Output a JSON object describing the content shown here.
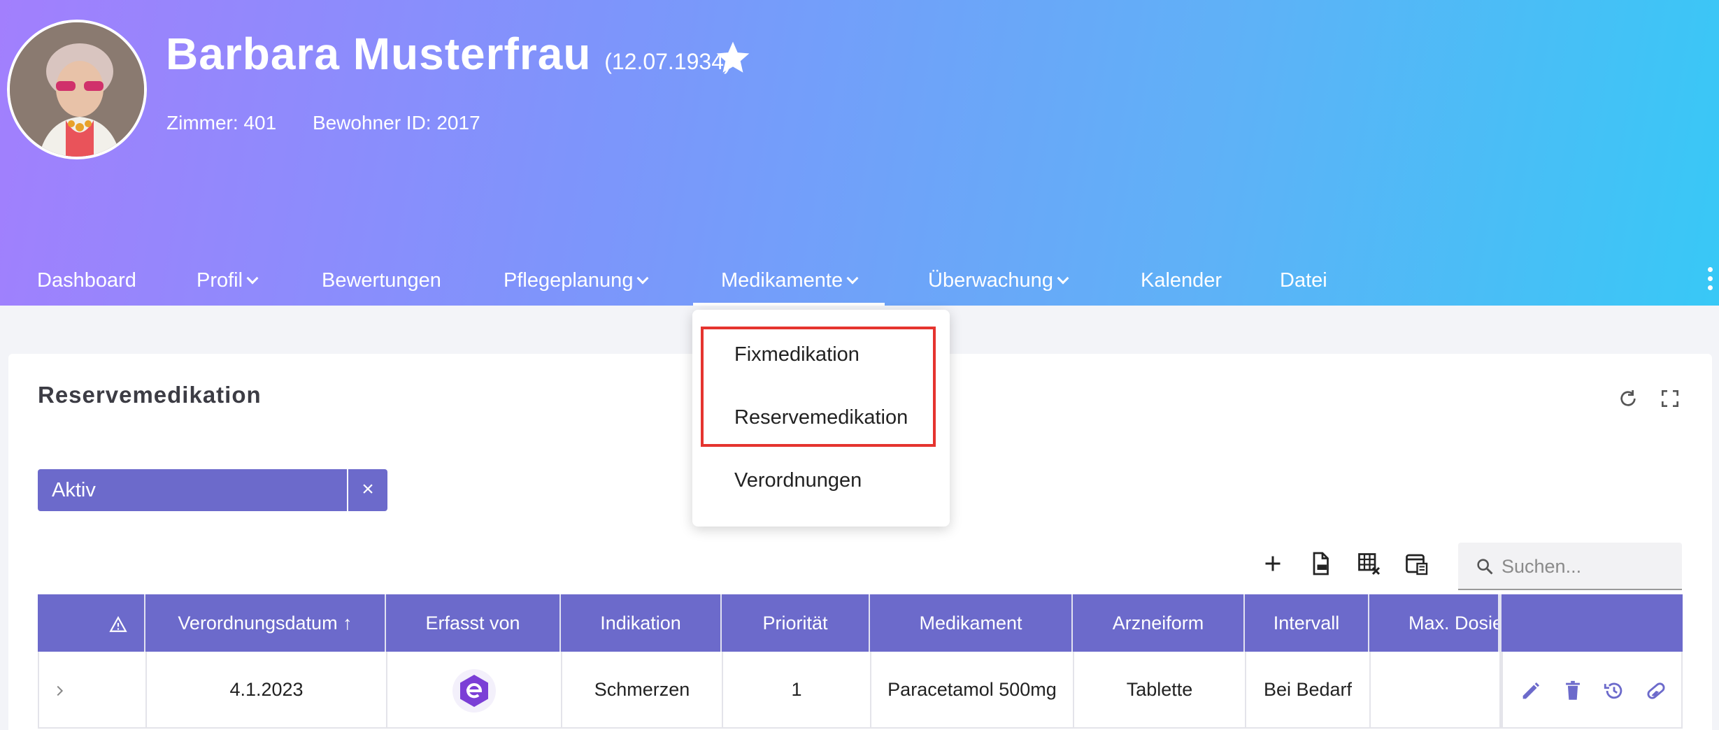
{
  "patient": {
    "name": "Barbara Musterfrau",
    "birthdate": "(12.07.1934)",
    "room": "Zimmer: 401",
    "resident_id": "Bewohner ID: 2017"
  },
  "nav": {
    "items": [
      {
        "label": "Dashboard"
      },
      {
        "label": "Profil"
      },
      {
        "label": "Bewertungen"
      },
      {
        "label": "Pflegeplanung"
      },
      {
        "label": "Medikamente"
      },
      {
        "label": "Überwachung"
      },
      {
        "label": "Kalender"
      },
      {
        "label": "Datei"
      }
    ]
  },
  "dropdown": {
    "items": [
      {
        "label": "Fixmedikation"
      },
      {
        "label": "Reservemedikation"
      },
      {
        "label": "Verordnungen"
      }
    ]
  },
  "card": {
    "title": "Reservemedikation",
    "filter_chip": "Aktiv",
    "filter_clear": "×",
    "search_placeholder": "Suchen..."
  },
  "table": {
    "headers": [
      "Verordnungsdatum ↑",
      "Erfasst von",
      "Indikation",
      "Priorität",
      "Medikament",
      "Arzneiform",
      "Intervall",
      "Max. Dosie"
    ],
    "rows": [
      {
        "date": "4.1.2023",
        "indication": "Schmerzen",
        "priority": "1",
        "medication": "Paracetamol 500mg",
        "form": "Tablette",
        "interval": "Bei Bedarf",
        "max_dose": ""
      }
    ]
  },
  "colors": {
    "accent": "#6c6acb",
    "highlight": "#e5342f"
  },
  "icons": [
    "star-icon",
    "kebab-menu-icon",
    "refresh-icon",
    "fullscreen-icon",
    "plus-icon",
    "pdf-icon",
    "table-clear-icon",
    "column-settings-icon",
    "search-icon",
    "warning-icon",
    "chevron-right-icon",
    "app-logo-icon",
    "edit-icon",
    "delete-icon",
    "history-icon",
    "pill-icon"
  ]
}
